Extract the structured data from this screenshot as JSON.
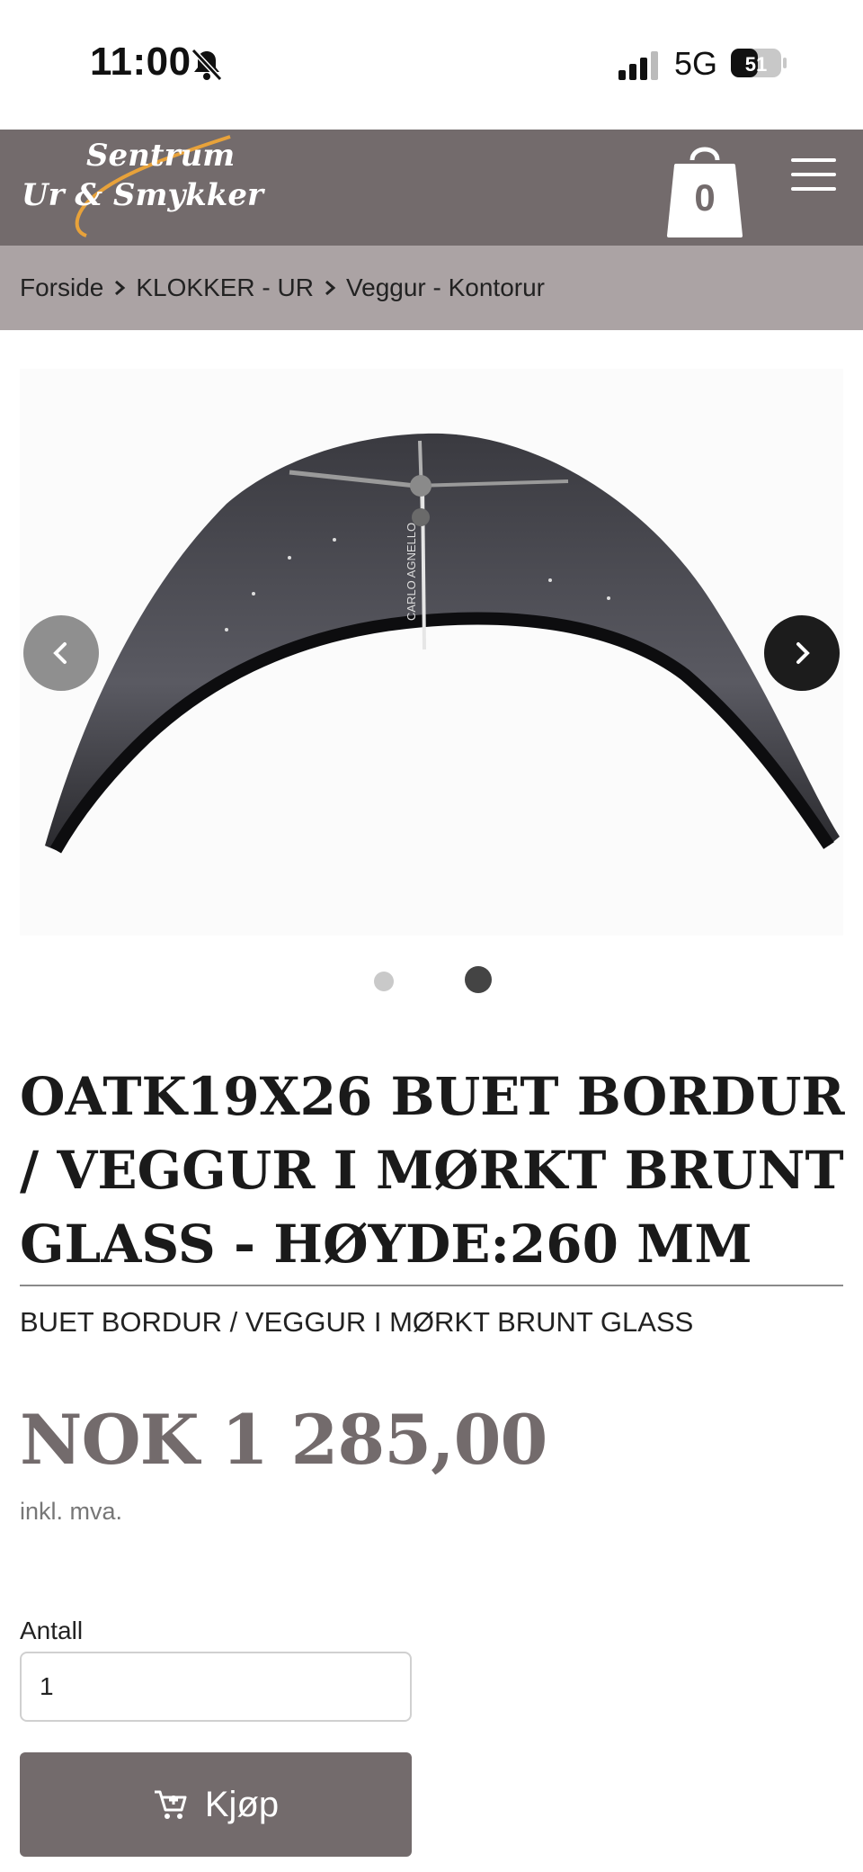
{
  "status_bar": {
    "time": "11:00",
    "network": "5G",
    "battery": "51",
    "icons": [
      "bell-slash-icon",
      "signal-icon",
      "battery-icon"
    ]
  },
  "header": {
    "logo_line1": "Sentrum",
    "logo_line2": "Ur & Smykker",
    "cart_count": "0",
    "icons": [
      "shopping-bag-icon",
      "hamburger-menu-icon"
    ],
    "colors": {
      "header_bg": "#736b6c",
      "breadcrumb_bg": "#aba3a4",
      "logo_swoosh": "#e8a23a"
    }
  },
  "breadcrumb": {
    "items": [
      "Forside",
      "KLOKKER - UR",
      "Veggur - Kontorur"
    ]
  },
  "gallery": {
    "image_label": "CARLO AGNELLO",
    "slide_count": 2,
    "active_slide": 2,
    "icons": [
      "chevron-left-icon",
      "chevron-right-icon"
    ]
  },
  "product": {
    "title": "OATK19X26 BUET BORDUR / VEGGUR I MØRKT BRUNT GLASS - HØYDE:260 MM",
    "subtitle": "BUET BORDUR / VEGGUR I MØRKT BRUNT GLASS",
    "price": "NOK 1 285,00",
    "vat_note": "inkl. mva.",
    "quantity_label": "Antall",
    "quantity_value": "1",
    "buy_label": "Kjøp"
  }
}
